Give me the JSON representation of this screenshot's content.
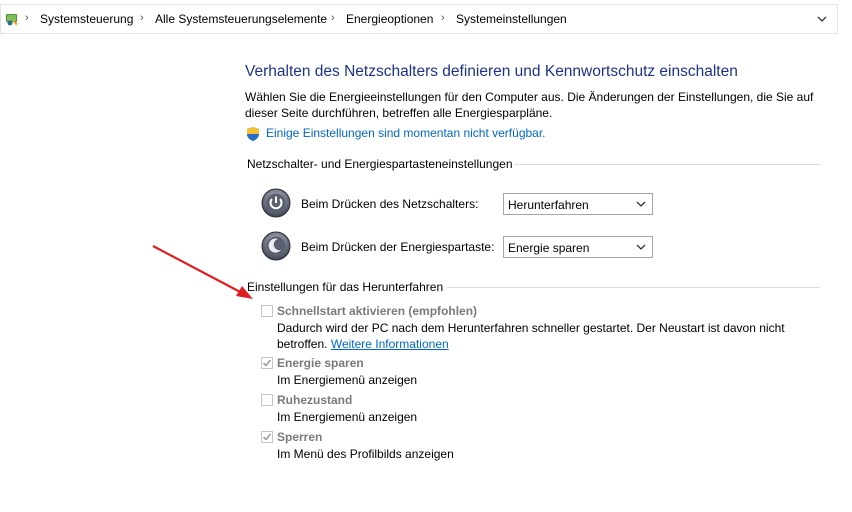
{
  "breadcrumb": {
    "items": [
      "Systemsteuerung",
      "Alle Systemsteuerungselemente",
      "Energieoptionen",
      "Systemeinstellungen"
    ]
  },
  "header": {
    "title": "Verhalten des Netzschalters definieren und Kennwortschutz einschalten",
    "description": "Wählen Sie die Energieeinstellungen für den Computer aus. Die Änderungen der Einstellungen, die Sie auf dieser Seite durchführen, betreffen alle Energiesparpläne.",
    "admin_link": "Einige Einstellungen sind momentan nicht verfügbar."
  },
  "buttons_section": {
    "title": "Netzschalter- und Energiespartasteneinstellungen",
    "power_button_label": "Beim Drücken des Netzschalters:",
    "power_button_value": "Herunterfahren",
    "sleep_button_label": "Beim Drücken der Energiespartaste:",
    "sleep_button_value": "Energie sparen"
  },
  "shutdown_section": {
    "title": "Einstellungen für das Herunterfahren",
    "fast_startup": {
      "title": "Schnellstart aktivieren (empfohlen)",
      "checked": false,
      "description": "Dadurch wird der PC nach dem Herunterfahren schneller gestartet. Der Neustart ist davon nicht betroffen.",
      "link": "Weitere Informationen"
    },
    "sleep": {
      "title": "Energie sparen",
      "subtitle": "Im Energiemenü anzeigen",
      "checked": true
    },
    "hibernate": {
      "title": "Ruhezustand",
      "subtitle": "Im Energiemenü anzeigen",
      "checked": false
    },
    "lock": {
      "title": "Sperren",
      "subtitle": "Im Menü des Profilbilds anzeigen",
      "checked": true
    }
  },
  "icons": {
    "location": "control-panel-icon",
    "separator": "chevron-right-icon",
    "dropdown": "chevron-down-icon",
    "shield": "uac-shield-icon",
    "power": "power-button-icon",
    "sleep": "sleep-button-icon"
  },
  "colors": {
    "title": "#1e3287",
    "link": "#0066cc",
    "annotation_arrow": "#e02020",
    "disabled_text": "#7a7a7a"
  }
}
